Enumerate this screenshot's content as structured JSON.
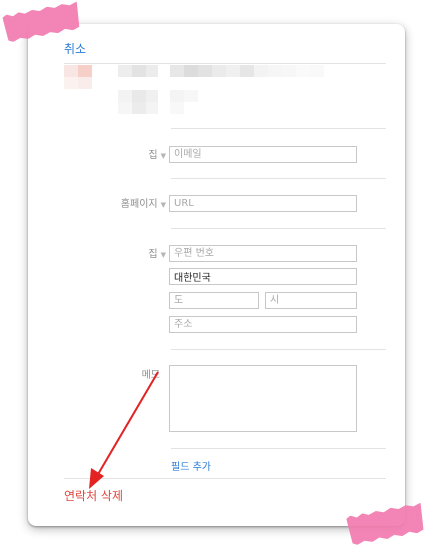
{
  "header": {
    "cancel_label": "취소"
  },
  "fields": {
    "email": {
      "label": "집",
      "placeholder": "이메일"
    },
    "homepage": {
      "label": "홈페이지",
      "placeholder": "URL"
    },
    "address": {
      "label": "집",
      "postal_placeholder": "우편 번호",
      "country_value": "대한민국",
      "province_placeholder": "도",
      "city_placeholder": "시",
      "street_placeholder": "주소"
    },
    "memo": {
      "label": "메모"
    }
  },
  "footer": {
    "add_field_label": "필드 추가",
    "delete_label": "연락처 삭제"
  },
  "colors": {
    "link": "#2b7bd9",
    "danger": "#e0473e",
    "tape": "#f27bb0",
    "arrow": "#e32222"
  },
  "icons": {
    "label_chevron": "chevron-down-icon"
  }
}
